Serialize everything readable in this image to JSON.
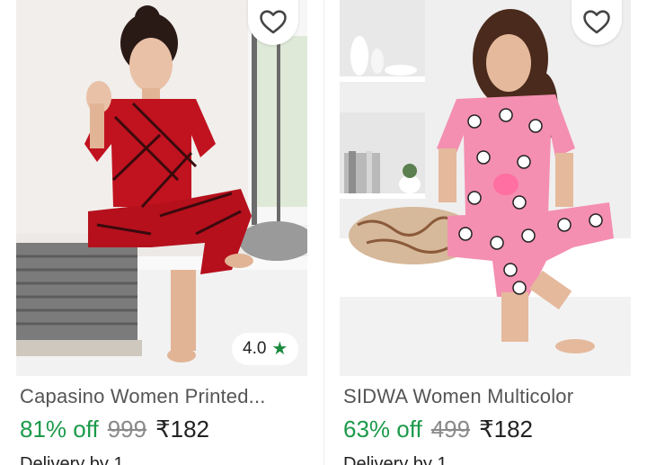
{
  "products": [
    {
      "title": "Capasino Women Printed...",
      "discount": "81% off",
      "mrp": "999",
      "price": "₹182",
      "rating": "4.0",
      "rating_icon": "star-icon",
      "wishlist_icon": "heart-outline-icon",
      "delivery": "Delivery by 1..."
    },
    {
      "title": "SIDWA Women Multicolor",
      "discount": "63% off",
      "mrp": "499",
      "price": "₹182",
      "wishlist_icon": "heart-outline-icon",
      "delivery": "Delivery by 1..."
    }
  ],
  "colors": {
    "discount": "#1c9a4a",
    "rating_star": "#1b8a3e",
    "title": "#555555",
    "mrp": "#8a8a8a"
  }
}
